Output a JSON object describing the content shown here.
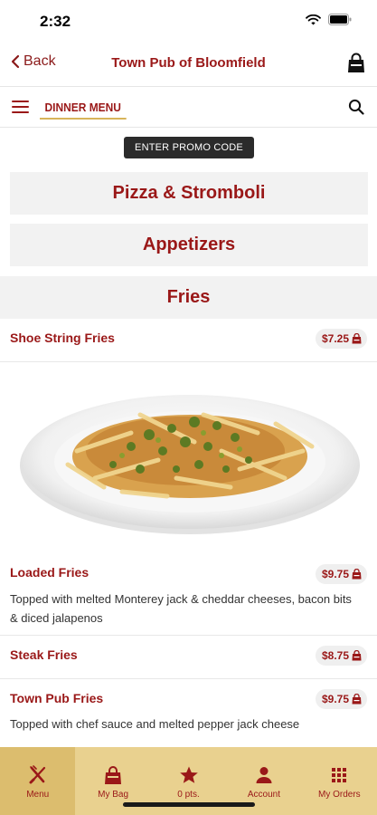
{
  "status": {
    "time": "2:32"
  },
  "nav": {
    "back_label": "Back",
    "title": "Town Pub of Bloomfield"
  },
  "menu_bar": {
    "active_tab": "DINNER MENU"
  },
  "promo": {
    "label": "ENTER PROMO CODE"
  },
  "categories": [
    {
      "label": "Pizza & Stromboli"
    },
    {
      "label": "Appetizers"
    },
    {
      "label": "Fries"
    }
  ],
  "items": [
    {
      "name": "Shoe String Fries",
      "price": "$7.25",
      "description": ""
    },
    {
      "name": "Loaded Fries",
      "price": "$9.75",
      "description": "Topped with melted Monterey jack & cheddar cheeses, bacon bits & diced jalapenos"
    },
    {
      "name": "Steak Fries",
      "price": "$8.75",
      "description": ""
    },
    {
      "name": "Town Pub Fries",
      "price": "$9.75",
      "description": "Topped with chef sauce and melted pepper jack cheese"
    }
  ],
  "tab_bar": [
    {
      "label": "Menu",
      "icon": "fork-knife-icon"
    },
    {
      "label": "My Bag",
      "icon": "bag-icon"
    },
    {
      "label": "0 pts.",
      "icon": "star-icon"
    },
    {
      "label": "Account",
      "icon": "person-icon"
    },
    {
      "label": "My Orders",
      "icon": "grid-icon"
    }
  ],
  "colors": {
    "brand_red": "#9a1818",
    "tab_gold": "#e9d18f",
    "tab_gold_active": "#dcbd6e"
  }
}
